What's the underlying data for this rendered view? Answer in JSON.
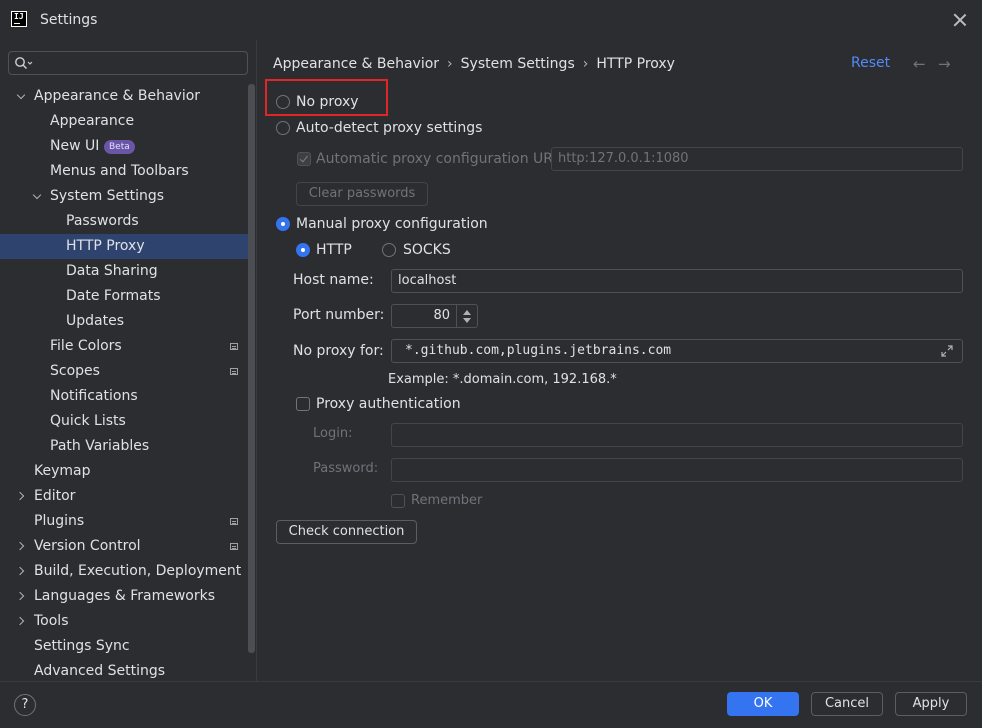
{
  "window": {
    "title": "Settings",
    "app_icon_text": "IJ"
  },
  "search": {
    "placeholder": ""
  },
  "tree": {
    "items": [
      {
        "label": "Appearance & Behavior"
      },
      {
        "label": "Appearance"
      },
      {
        "label": "New UI",
        "badge": "Beta"
      },
      {
        "label": "Menus and Toolbars"
      },
      {
        "label": "System Settings"
      },
      {
        "label": "Passwords"
      },
      {
        "label": "HTTP Proxy"
      },
      {
        "label": "Data Sharing"
      },
      {
        "label": "Date Formats"
      },
      {
        "label": "Updates"
      },
      {
        "label": "File Colors"
      },
      {
        "label": "Scopes"
      },
      {
        "label": "Notifications"
      },
      {
        "label": "Quick Lists"
      },
      {
        "label": "Path Variables"
      },
      {
        "label": "Keymap"
      },
      {
        "label": "Editor"
      },
      {
        "label": "Plugins"
      },
      {
        "label": "Version Control"
      },
      {
        "label": "Build, Execution, Deployment"
      },
      {
        "label": "Languages & Frameworks"
      },
      {
        "label": "Tools"
      },
      {
        "label": "Settings Sync"
      },
      {
        "label": "Advanced Settings"
      }
    ]
  },
  "breadcrumb": [
    "Appearance & Behavior",
    "System Settings",
    "HTTP Proxy"
  ],
  "header": {
    "reset": "Reset",
    "back": "←",
    "forward": "→"
  },
  "proxy": {
    "no_proxy": "No proxy",
    "auto_detect": "Auto-detect proxy settings",
    "auto_config_url_label": "Automatic proxy configuration URL:",
    "auto_config_url_value": "http:127.0.0.1:1080",
    "clear_passwords": "Clear passwords",
    "manual": "Manual proxy configuration",
    "http": "HTTP",
    "socks": "SOCKS",
    "host_label": "Host name:",
    "host_value": "localhost",
    "port_label": "Port number:",
    "port_value": "80",
    "no_proxy_for_label": "No proxy for:",
    "no_proxy_for_value": "*.github.com,plugins.jetbrains.com",
    "example": "Example: *.domain.com, 192.168.*",
    "auth_label": "Proxy authentication",
    "login_label": "Login:",
    "password_label": "Password:",
    "remember": "Remember",
    "check_connection": "Check connection"
  },
  "footer": {
    "help": "?",
    "ok": "OK",
    "cancel": "Cancel",
    "apply": "Apply"
  },
  "colors": {
    "accent": "#3574f0",
    "selection": "#2e436e",
    "link": "#548af7",
    "highlight_box": "#e02626"
  }
}
